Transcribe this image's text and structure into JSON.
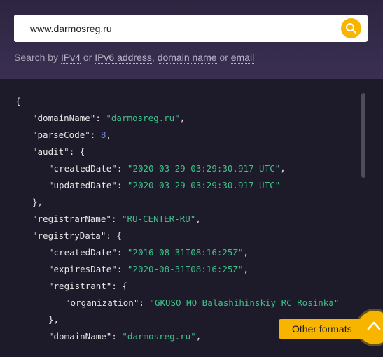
{
  "search": {
    "value": "www.darmosreg.ru",
    "button_icon": "search-icon"
  },
  "hint": {
    "prefix": "Search by ",
    "ipv4": "IPv4",
    "or1": " or ",
    "ipv6": "IPv6 address",
    "comma": ", ",
    "domain": "domain name",
    "or2": " or ",
    "email": "email"
  },
  "json_lines": [
    [
      {
        "t": "{",
        "c": "punc"
      }
    ],
    [
      {
        "t": "\"domainName\"",
        "c": "key"
      },
      {
        "t": ": ",
        "c": "punc"
      },
      {
        "t": "\"darmosreg.ru\"",
        "c": "str"
      },
      {
        "t": ",",
        "c": "punc"
      }
    ],
    [
      {
        "t": "\"parseCode\"",
        "c": "key"
      },
      {
        "t": ": ",
        "c": "punc"
      },
      {
        "t": "8",
        "c": "num"
      },
      {
        "t": ",",
        "c": "punc"
      }
    ],
    [
      {
        "t": "\"audit\"",
        "c": "key"
      },
      {
        "t": ": {",
        "c": "punc"
      }
    ],
    [
      {
        "t": "\"createdDate\"",
        "c": "key"
      },
      {
        "t": ": ",
        "c": "punc"
      },
      {
        "t": "\"2020-03-29 03:29:30.917 UTC\"",
        "c": "str"
      },
      {
        "t": ",",
        "c": "punc"
      }
    ],
    [
      {
        "t": "\"updatedDate\"",
        "c": "key"
      },
      {
        "t": ": ",
        "c": "punc"
      },
      {
        "t": "\"2020-03-29 03:29:30.917 UTC\"",
        "c": "str"
      }
    ],
    [
      {
        "t": "},",
        "c": "punc"
      }
    ],
    [
      {
        "t": "\"registrarName\"",
        "c": "key"
      },
      {
        "t": ": ",
        "c": "punc"
      },
      {
        "t": "\"RU-CENTER-RU\"",
        "c": "str"
      },
      {
        "t": ",",
        "c": "punc"
      }
    ],
    [
      {
        "t": "\"registryData\"",
        "c": "key"
      },
      {
        "t": ": {",
        "c": "punc"
      }
    ],
    [
      {
        "t": "\"createdDate\"",
        "c": "key"
      },
      {
        "t": ": ",
        "c": "punc"
      },
      {
        "t": "\"2016-08-31T08:16:25Z\"",
        "c": "str"
      },
      {
        "t": ",",
        "c": "punc"
      }
    ],
    [
      {
        "t": "\"expiresDate\"",
        "c": "key"
      },
      {
        "t": ": ",
        "c": "punc"
      },
      {
        "t": "\"2020-08-31T08:16:25Z\"",
        "c": "str"
      },
      {
        "t": ",",
        "c": "punc"
      }
    ],
    [
      {
        "t": "\"registrant\"",
        "c": "key"
      },
      {
        "t": ": {",
        "c": "punc"
      }
    ],
    [
      {
        "t": "\"organization\"",
        "c": "key"
      },
      {
        "t": ": ",
        "c": "punc"
      },
      {
        "t": "\"GKUSO MO Balashihinskiy RC Rosinka\"",
        "c": "str"
      }
    ],
    [
      {
        "t": "},",
        "c": "punc"
      }
    ],
    [
      {
        "t": "\"domainName\"",
        "c": "key"
      },
      {
        "t": ": ",
        "c": "punc"
      },
      {
        "t": "\"darmosreg.ru\"",
        "c": "str"
      },
      {
        "t": ",",
        "c": "punc"
      }
    ]
  ],
  "other_formats_label": "Other formats",
  "to_top_icon": "chevron-up-icon",
  "colors": {
    "accent": "#f7b500",
    "string": "#3ec088",
    "number": "#6c8bd8",
    "background": "#1d1b2a"
  }
}
